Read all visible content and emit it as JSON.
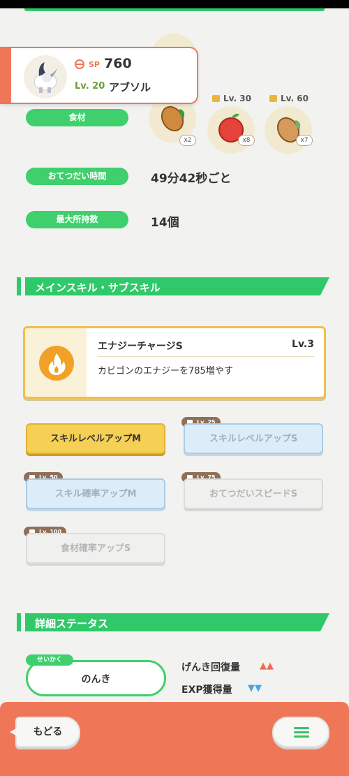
{
  "header_card": {
    "sp_label": "SP",
    "sp_value": "760",
    "level": "Lv. 20",
    "name": "アブソル"
  },
  "ingredients": {
    "label": "食材",
    "items": [
      {
        "name": "cacao-icon",
        "count": "x2",
        "unlock": ""
      },
      {
        "name": "apple-icon",
        "count": "x8",
        "unlock": "Lv. 30"
      },
      {
        "name": "cacao-icon",
        "count": "x7",
        "unlock": "Lv. 60"
      }
    ]
  },
  "help_time": {
    "label": "おてつだい時間",
    "value": "49分42秒ごと"
  },
  "max_carry": {
    "label": "最大所持数",
    "value": "14個"
  },
  "skills_section": {
    "title": "メインスキル・サブスキル"
  },
  "main_skill": {
    "name": "エナジーチャージS",
    "level": "Lv.3",
    "description": "カビゴンのエナジーを785増やす",
    "icon": "flame-icon"
  },
  "sub_skills": [
    {
      "label": "スキルレベルアップM",
      "unlock": "",
      "state": "unlocked"
    },
    {
      "label": "スキルレベルアップS",
      "unlock": "Lv. 25",
      "state": "locked-blue"
    },
    {
      "label": "スキル確率アップM",
      "unlock": "Lv. 50",
      "state": "locked-blue"
    },
    {
      "label": "おてつだいスピードS",
      "unlock": "Lv. 75",
      "state": "locked-gray"
    },
    {
      "label": "食材確率アップS",
      "unlock": "Lv. 100",
      "state": "locked-gray"
    }
  ],
  "status_section": {
    "title": "詳細ステータス"
  },
  "nature": {
    "tag": "せいかく",
    "value": "のんき",
    "up_label": "げんき回復量",
    "up_arrows": "▲▲",
    "down_label": "EXP獲得量",
    "down_arrows": "▼▼"
  },
  "footer": {
    "back_label": "もどる",
    "menu_icon": "hamburger-menu-icon"
  },
  "colors": {
    "accent_green": "#2fc96a",
    "footer_orange": "#ef7758",
    "gold": "#f5d054",
    "up_red": "#ee6b4d",
    "down_blue": "#4aa3e6"
  }
}
